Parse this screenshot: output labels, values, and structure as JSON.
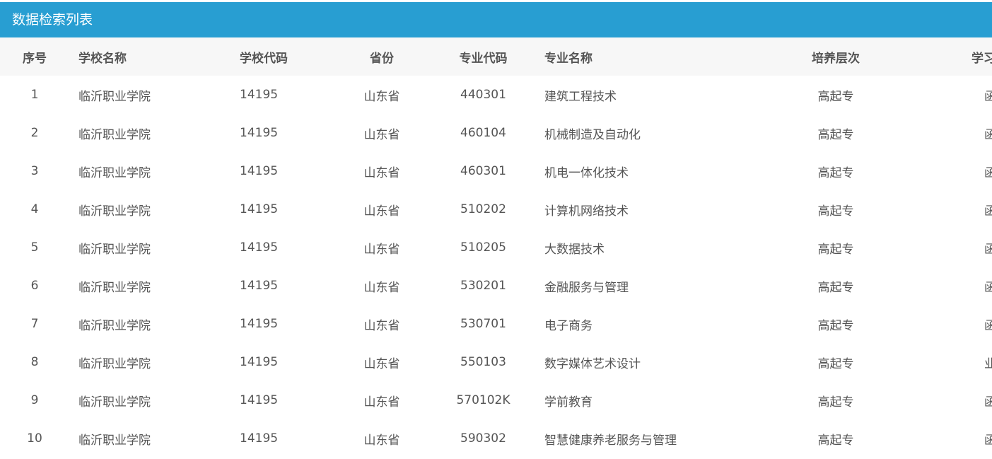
{
  "panel": {
    "title": "数据检索列表"
  },
  "table": {
    "columns": [
      "序号",
      "学校名称",
      "学校代码",
      "省份",
      "专业代码",
      "专业名称",
      "培养层次",
      "学习形式"
    ],
    "rows": [
      [
        "1",
        "临沂职业学院",
        "14195",
        "山东省",
        "440301",
        "建筑工程技术",
        "高起专",
        "函授"
      ],
      [
        "2",
        "临沂职业学院",
        "14195",
        "山东省",
        "460104",
        "机械制造及自动化",
        "高起专",
        "函授"
      ],
      [
        "3",
        "临沂职业学院",
        "14195",
        "山东省",
        "460301",
        "机电一体化技术",
        "高起专",
        "函授"
      ],
      [
        "4",
        "临沂职业学院",
        "14195",
        "山东省",
        "510202",
        "计算机网络技术",
        "高起专",
        "函授"
      ],
      [
        "5",
        "临沂职业学院",
        "14195",
        "山东省",
        "510205",
        "大数据技术",
        "高起专",
        "函授"
      ],
      [
        "6",
        "临沂职业学院",
        "14195",
        "山东省",
        "530201",
        "金融服务与管理",
        "高起专",
        "函授"
      ],
      [
        "7",
        "临沂职业学院",
        "14195",
        "山东省",
        "530701",
        "电子商务",
        "高起专",
        "函授"
      ],
      [
        "8",
        "临沂职业学院",
        "14195",
        "山东省",
        "550103",
        "数字媒体艺术设计",
        "高起专",
        "业余"
      ],
      [
        "9",
        "临沂职业学院",
        "14195",
        "山东省",
        "570102K",
        "学前教育",
        "高起专",
        "函授"
      ],
      [
        "10",
        "临沂职业学院",
        "14195",
        "山东省",
        "590302",
        "智慧健康养老服务与管理",
        "高起专",
        "函授"
      ]
    ]
  },
  "colors": {
    "header_bg": "#289ed2",
    "table_head_bg": "#f7f7f7",
    "text": "#555555"
  }
}
